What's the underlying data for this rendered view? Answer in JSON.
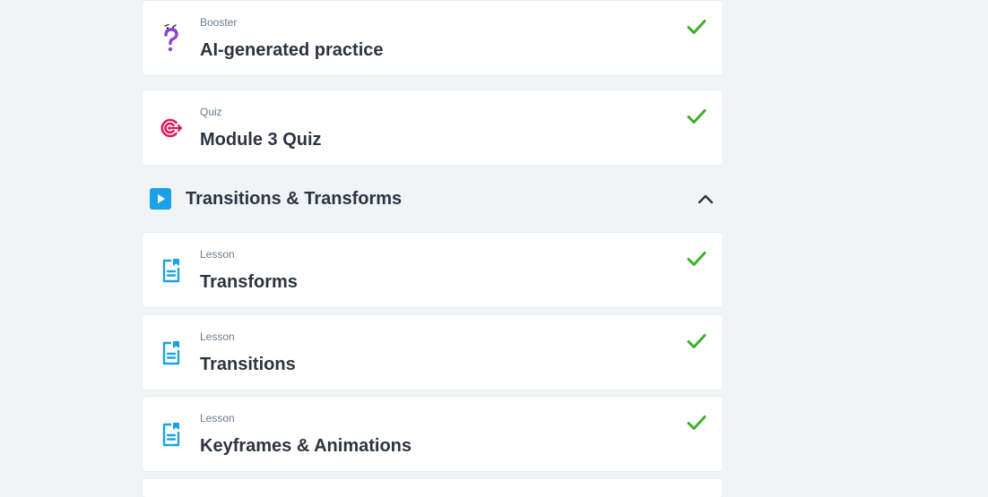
{
  "items": [
    {
      "kind": "Booster",
      "title": "AI-generated practice",
      "icon": "question-mark-icon",
      "completed": true
    },
    {
      "kind": "Quiz",
      "title": "Module 3 Quiz",
      "icon": "target-icon",
      "completed": true
    }
  ],
  "section": {
    "title": "Transitions & Transforms",
    "icon": "play-icon",
    "expanded": true,
    "items": [
      {
        "kind": "Lesson",
        "title": "Transforms",
        "icon": "lesson-document-icon",
        "completed": true
      },
      {
        "kind": "Lesson",
        "title": "Transitions",
        "icon": "lesson-document-icon",
        "completed": true
      },
      {
        "kind": "Lesson",
        "title": "Keyframes & Animations",
        "icon": "lesson-document-icon",
        "completed": true
      }
    ]
  },
  "colors": {
    "background": "#f1f4f7",
    "check": "#3fae2a",
    "accent_blue": "#1ba1e8",
    "quiz_pink": "#e2185b",
    "booster_purple": "#8a43d6"
  }
}
